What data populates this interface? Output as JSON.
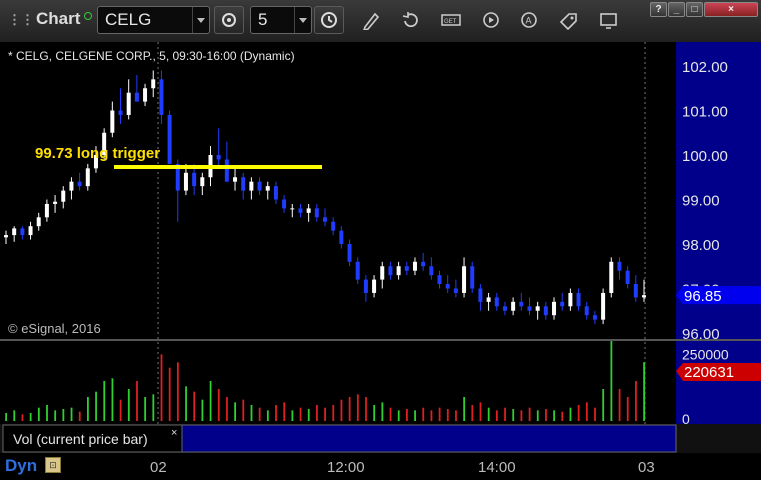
{
  "toolbar": {
    "title": "Chart",
    "symbol": "CELG",
    "interval": "5",
    "buttons": [
      "interval-clock",
      "pencil",
      "refresh",
      "get-quote",
      "play",
      "alert",
      "tag",
      "screen"
    ]
  },
  "window_controls": [
    "?",
    "_",
    "□",
    "×"
  ],
  "chart": {
    "legend": "* CELG, CELGENE CORP., 5, 09:30-16:00 (Dynamic)",
    "copyright": "© eSignal, 2016",
    "annotation": "99.73 long trigger",
    "last_price": "96.85",
    "last_volume": "220631",
    "volume_panel_title": "Vol (current price bar)",
    "volume_close": "×",
    "dyn_label": "Dyn",
    "price_ticks": [
      "102.00",
      "101.00",
      "100.00",
      "99.00",
      "98.00",
      "97.00",
      "96.00"
    ],
    "volume_ticks": [
      "250000",
      "0"
    ],
    "x_ticks": [
      "02",
      "12:00",
      "14:00",
      "03"
    ],
    "colors": {
      "up": "#ffffff",
      "down": "#1f3cff",
      "trigger": "#ffff00",
      "vol_up": "#30d030",
      "vol_down": "#dd2020",
      "axis_bg": "#00008a",
      "price_tag": "#0000ee",
      "vol_tag": "#cc0000"
    }
  },
  "chart_data": {
    "type": "candlestick",
    "title": "* CELG, CELGENE CORP., 5, 09:30-16:00 (Dynamic)",
    "ylim": [
      95.9,
      102.4
    ],
    "trigger_level": 99.73,
    "last": 96.85,
    "candles": [
      [
        98.15,
        98.3,
        98.0,
        98.2,
        30000
      ],
      [
        98.2,
        98.4,
        98.05,
        98.35,
        40000
      ],
      [
        98.35,
        98.4,
        98.1,
        98.2,
        25000
      ],
      [
        98.2,
        98.5,
        98.1,
        98.4,
        30000
      ],
      [
        98.4,
        98.7,
        98.3,
        98.6,
        50000
      ],
      [
        98.6,
        99.0,
        98.5,
        98.9,
        60000
      ],
      [
        98.9,
        99.1,
        98.7,
        98.95,
        40000
      ],
      [
        98.95,
        99.3,
        98.8,
        99.2,
        45000
      ],
      [
        99.2,
        99.5,
        99.0,
        99.4,
        50000
      ],
      [
        99.4,
        99.6,
        99.2,
        99.3,
        35000
      ],
      [
        99.3,
        99.8,
        99.2,
        99.7,
        90000
      ],
      [
        99.7,
        100.2,
        99.6,
        100.0,
        110000
      ],
      [
        100.0,
        100.6,
        99.9,
        100.5,
        150000
      ],
      [
        100.5,
        101.2,
        100.4,
        101.0,
        160000
      ],
      [
        101.0,
        101.5,
        100.7,
        100.9,
        80000
      ],
      [
        100.9,
        101.7,
        100.8,
        101.4,
        120000
      ],
      [
        101.4,
        101.8,
        101.2,
        101.2,
        150000
      ],
      [
        101.2,
        101.6,
        101.1,
        101.5,
        90000
      ],
      [
        101.5,
        101.9,
        101.3,
        101.7,
        100000
      ],
      [
        101.7,
        101.9,
        100.7,
        100.9,
        250000
      ],
      [
        100.9,
        101.0,
        99.9,
        99.8,
        200000
      ],
      [
        99.8,
        99.9,
        98.5,
        99.2,
        220000
      ],
      [
        99.2,
        99.8,
        99.1,
        99.6,
        130000
      ],
      [
        99.6,
        99.8,
        99.1,
        99.3,
        110000
      ],
      [
        99.3,
        99.6,
        99.1,
        99.5,
        80000
      ],
      [
        99.5,
        100.2,
        99.3,
        100.0,
        150000
      ],
      [
        100.0,
        100.6,
        99.7,
        99.9,
        120000
      ],
      [
        99.9,
        100.3,
        99.4,
        99.4,
        90000
      ],
      [
        99.4,
        99.7,
        99.2,
        99.5,
        70000
      ],
      [
        99.5,
        99.6,
        99.0,
        99.2,
        80000
      ],
      [
        99.2,
        99.5,
        99.0,
        99.4,
        60000
      ],
      [
        99.4,
        99.5,
        99.1,
        99.2,
        50000
      ],
      [
        99.2,
        99.4,
        99.0,
        99.3,
        40000
      ],
      [
        99.3,
        99.4,
        98.9,
        99.0,
        60000
      ],
      [
        99.0,
        99.1,
        98.7,
        98.8,
        70000
      ],
      [
        98.8,
        98.9,
        98.6,
        98.8,
        40000
      ],
      [
        98.8,
        98.9,
        98.6,
        98.7,
        50000
      ],
      [
        98.7,
        98.9,
        98.5,
        98.8,
        45000
      ],
      [
        98.8,
        98.9,
        98.5,
        98.6,
        60000
      ],
      [
        98.6,
        98.8,
        98.4,
        98.5,
        50000
      ],
      [
        98.5,
        98.6,
        98.2,
        98.3,
        60000
      ],
      [
        98.3,
        98.4,
        97.9,
        98.0,
        80000
      ],
      [
        98.0,
        98.1,
        97.5,
        97.6,
        90000
      ],
      [
        97.6,
        97.7,
        97.1,
        97.2,
        100000
      ],
      [
        97.2,
        97.3,
        96.7,
        96.9,
        90000
      ],
      [
        96.9,
        97.3,
        96.8,
        97.2,
        60000
      ],
      [
        97.2,
        97.6,
        97.0,
        97.5,
        70000
      ],
      [
        97.5,
        97.6,
        97.2,
        97.3,
        50000
      ],
      [
        97.3,
        97.6,
        97.2,
        97.5,
        40000
      ],
      [
        97.5,
        97.6,
        97.3,
        97.4,
        45000
      ],
      [
        97.4,
        97.7,
        97.3,
        97.6,
        40000
      ],
      [
        97.6,
        97.8,
        97.4,
        97.5,
        50000
      ],
      [
        97.5,
        97.7,
        97.2,
        97.3,
        40000
      ],
      [
        97.3,
        97.4,
        97.0,
        97.1,
        50000
      ],
      [
        97.1,
        97.3,
        96.9,
        97.0,
        45000
      ],
      [
        97.0,
        97.2,
        96.8,
        96.9,
        40000
      ],
      [
        96.9,
        97.7,
        96.8,
        97.5,
        90000
      ],
      [
        97.5,
        97.6,
        96.9,
        97.0,
        60000
      ],
      [
        97.0,
        97.1,
        96.5,
        96.7,
        70000
      ],
      [
        96.7,
        96.9,
        96.5,
        96.8,
        50000
      ],
      [
        96.8,
        96.9,
        96.5,
        96.6,
        40000
      ],
      [
        96.6,
        96.7,
        96.4,
        96.5,
        50000
      ],
      [
        96.5,
        96.8,
        96.4,
        96.7,
        45000
      ],
      [
        96.7,
        96.9,
        96.5,
        96.6,
        40000
      ],
      [
        96.6,
        96.8,
        96.4,
        96.5,
        50000
      ],
      [
        96.5,
        96.7,
        96.3,
        96.6,
        40000
      ],
      [
        96.6,
        96.7,
        96.3,
        96.4,
        45000
      ],
      [
        96.4,
        96.8,
        96.3,
        96.7,
        40000
      ],
      [
        96.7,
        96.9,
        96.5,
        96.6,
        35000
      ],
      [
        96.6,
        97.0,
        96.5,
        96.9,
        50000
      ],
      [
        96.9,
        97.0,
        96.5,
        96.6,
        60000
      ],
      [
        96.6,
        96.7,
        96.3,
        96.4,
        70000
      ],
      [
        96.4,
        96.5,
        96.2,
        96.3,
        50000
      ],
      [
        96.3,
        97.0,
        96.2,
        96.9,
        120000
      ],
      [
        96.9,
        97.7,
        96.8,
        97.6,
        300000
      ],
      [
        97.6,
        97.7,
        97.2,
        97.4,
        120000
      ],
      [
        97.4,
        97.5,
        97.0,
        97.1,
        90000
      ],
      [
        97.1,
        97.3,
        96.7,
        96.8,
        150000
      ],
      [
        96.8,
        97.2,
        96.7,
        96.85,
        220631
      ]
    ]
  }
}
